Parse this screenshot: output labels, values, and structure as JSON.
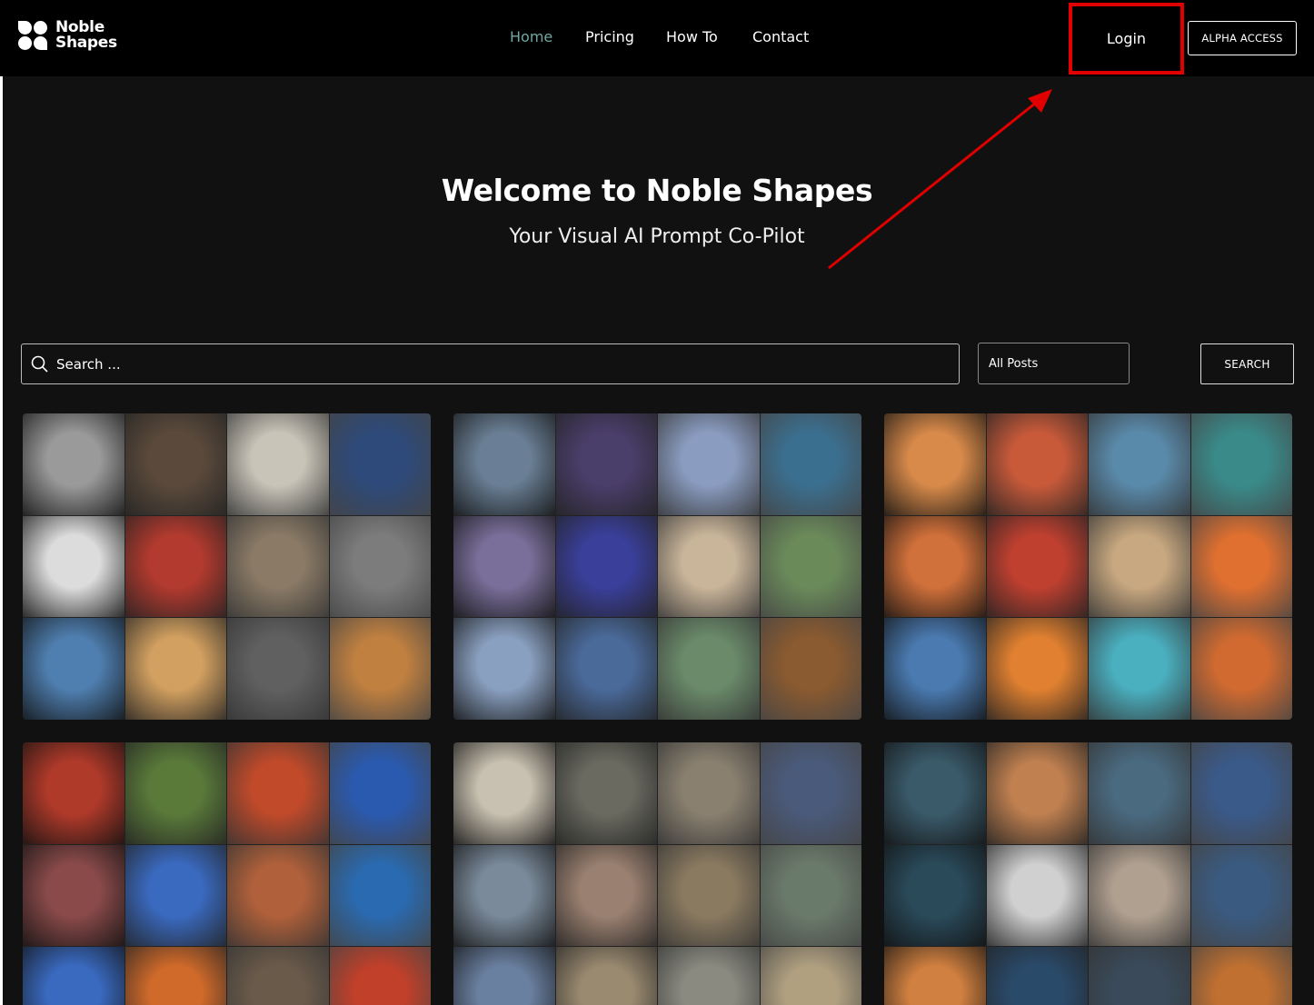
{
  "header": {
    "logo_line1": "Noble",
    "logo_line2": "Shapes",
    "nav": [
      {
        "label": "Home",
        "active": true
      },
      {
        "label": "Pricing",
        "active": false
      },
      {
        "label": "How To",
        "active": false
      },
      {
        "label": "Contact",
        "active": false
      }
    ],
    "login_label": "Login",
    "alpha_label": "ALPHA ACCESS",
    "highlight_color": "#e00000",
    "active_nav_color": "#6fa8a3"
  },
  "hero": {
    "title": "Welcome to Noble Shapes",
    "subtitle": "Your Visual AI Prompt Co-Pilot"
  },
  "search": {
    "placeholder": "Search ...",
    "filter_value": "All Posts",
    "button_label": "SEARCH"
  },
  "gallery": {
    "cards": [
      {
        "style": "sketch",
        "palette": [
          "#9a9a9a",
          "#5b4a3c",
          "#c9c4b8",
          "#2e4a7a",
          "#dcdcdc",
          "#b33a2e",
          "#8a7a66",
          "#7c7c7c",
          "#4f7fb0",
          "#d2a060",
          "#606060",
          "#c08040"
        ]
      },
      {
        "style": "fantasy",
        "palette": [
          "#6a7f95",
          "#4a3e6a",
          "#8a9cc0",
          "#3b6f8f",
          "#7a6f9a",
          "#3a3f9a",
          "#c9b59a",
          "#6a8a5a",
          "#8aa0c0",
          "#4a6a9a",
          "#6a8a6a",
          "#8a5a30"
        ]
      },
      {
        "style": "vivid",
        "palette": [
          "#d88a4a",
          "#c85a3a",
          "#5a8aaa",
          "#3a8a8a",
          "#d0703a",
          "#c04030",
          "#c8a880",
          "#e07030",
          "#4a7ab0",
          "#e08030",
          "#4ab0c0",
          "#d06a30"
        ]
      },
      {
        "style": "saturated",
        "palette": [
          "#b03a2a",
          "#5a7a3a",
          "#c04a2a",
          "#2a5ab0",
          "#8a4a4a",
          "#3a6ac0",
          "#b0603a",
          "#2a6ab0",
          "#3a6ac0",
          "#d06a2a",
          "#6a5a4a",
          "#c0402a"
        ]
      },
      {
        "style": "muted",
        "palette": [
          "#c8c0b0",
          "#6a6a60",
          "#8a8070",
          "#4a5a7a",
          "#7a8a9a",
          "#9a8070",
          "#8a7a60",
          "#6a7a6a",
          "#6a80a0",
          "#9a8a70",
          "#8a8a80",
          "#b0a080"
        ]
      },
      {
        "style": "japanese",
        "palette": [
          "#3a5a6a",
          "#c08050",
          "#4a6a80",
          "#3a5a8a",
          "#2a4a5a",
          "#d0d0d0",
          "#b0a090",
          "#3a5a80",
          "#d08040",
          "#2a4a6a",
          "#3a4a5a",
          "#c07030"
        ]
      }
    ]
  }
}
